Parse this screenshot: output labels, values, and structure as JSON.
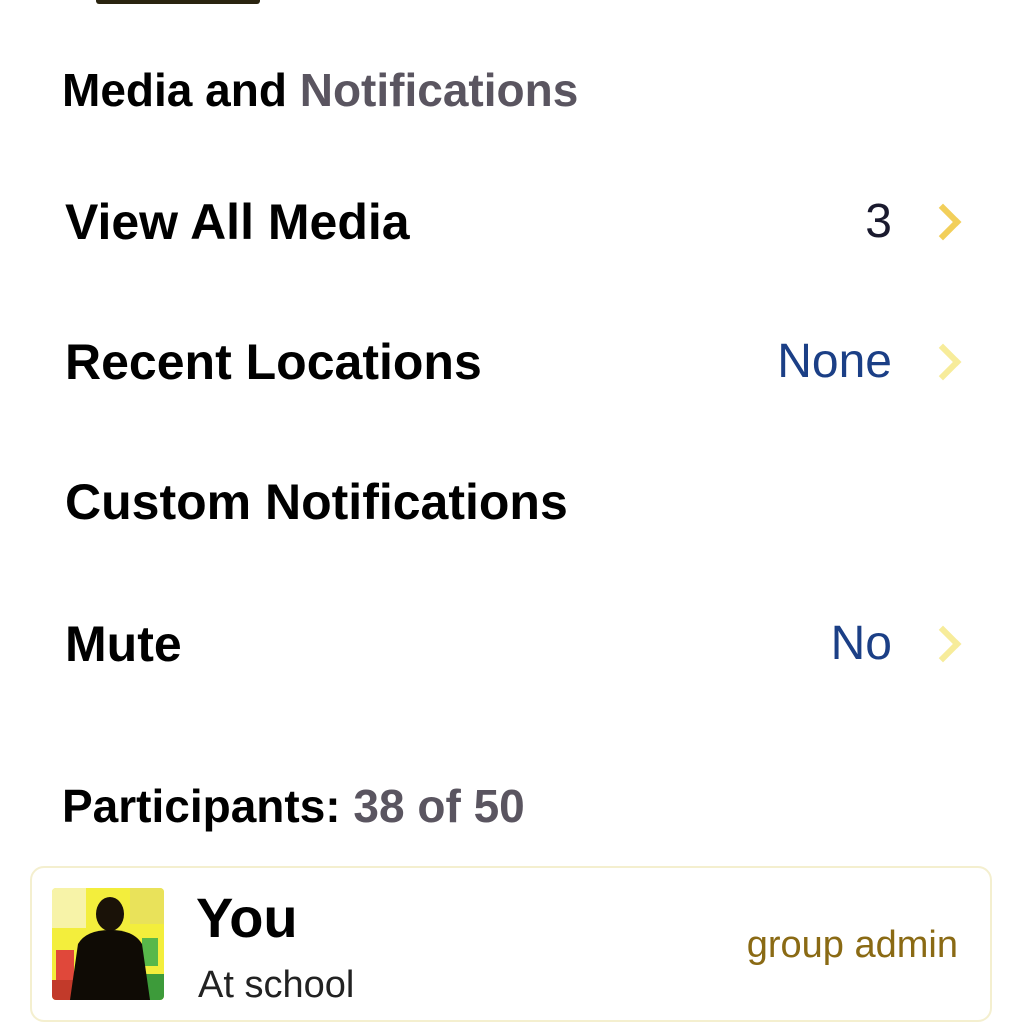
{
  "media_section": {
    "title_main": "Media and",
    "title_rest": "Notifications"
  },
  "rows": {
    "view_all_media": {
      "label": "View All Media",
      "value": "3"
    },
    "recent_locations": {
      "label": "Recent Locations",
      "value": "None"
    },
    "custom_notifications": {
      "label": "Custom Notifications"
    },
    "mute": {
      "label": "Mute",
      "value": "No"
    }
  },
  "participants_section": {
    "title_main": "Participants:",
    "count": "38 of 50"
  },
  "participant": {
    "name": "You",
    "status": "At school",
    "role": "group admin"
  },
  "colors": {
    "accent_chevron": "#f2cf5a",
    "value_blue": "#1b3f86",
    "admin_role": "#8a6a14"
  },
  "icons": {
    "disclosure": "chevron-right-icon",
    "avatar": "user-avatar"
  }
}
